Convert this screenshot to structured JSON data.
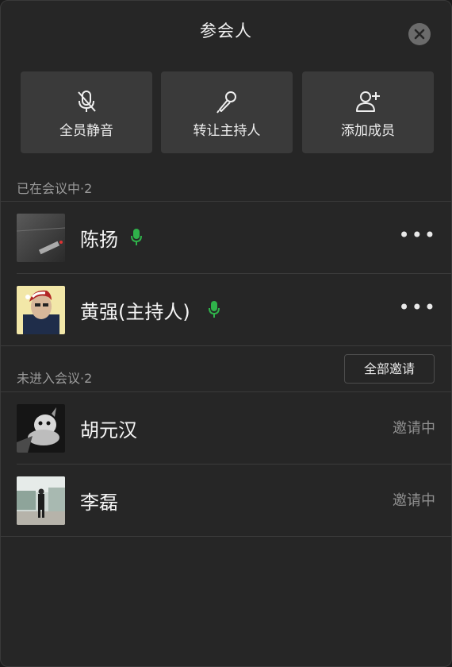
{
  "header": {
    "title": "参会人"
  },
  "actions": [
    {
      "label": "全员静音",
      "icon": "mic-muted-icon"
    },
    {
      "label": "转让主持人",
      "icon": "microphone-icon"
    },
    {
      "label": "添加成员",
      "icon": "add-user-icon"
    }
  ],
  "joined": {
    "label": "已在会议中·2",
    "members": [
      {
        "name": "陈扬",
        "mic": "mic-on",
        "menu": "•••"
      },
      {
        "name": "黄强(主持人)",
        "mic": "mic-on",
        "menu": "•••"
      }
    ]
  },
  "pending": {
    "label": "未进入会议·2",
    "invite_all": "全部邀请",
    "members": [
      {
        "name": "胡元汉",
        "status": "邀请中"
      },
      {
        "name": "李磊",
        "status": "邀请中"
      }
    ]
  },
  "colors": {
    "mic_green": "#2fb24a",
    "background": "#262626",
    "button_bg": "#3a3a3a"
  }
}
